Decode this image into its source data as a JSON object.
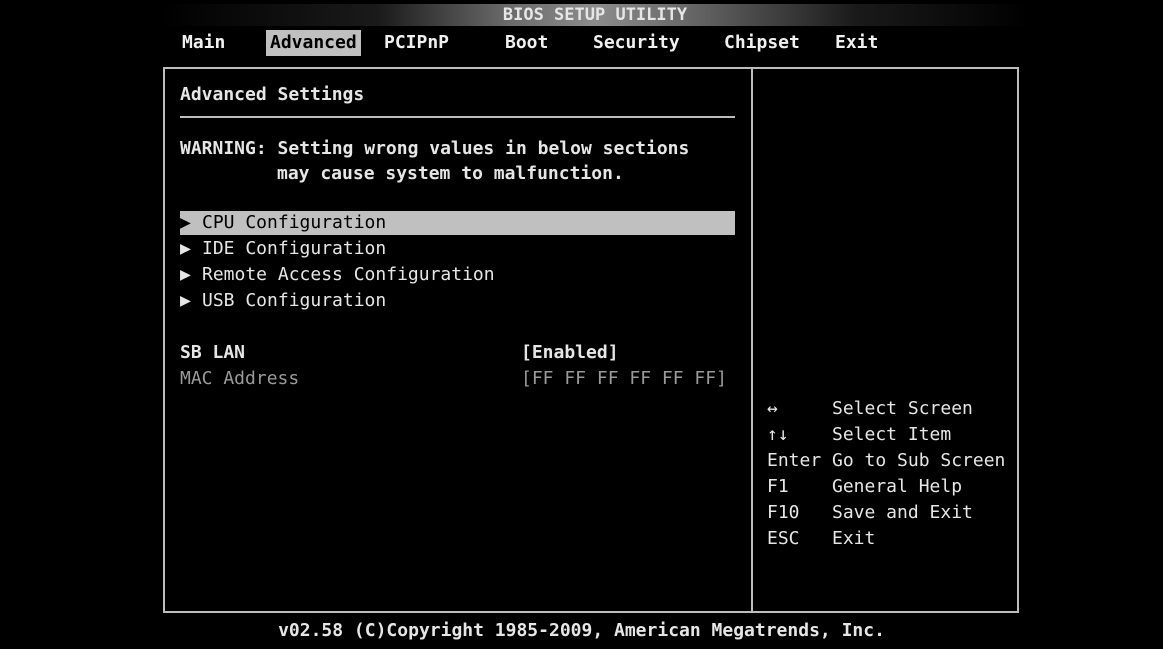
{
  "title": "BIOS SETUP UTILITY",
  "menu": {
    "main": "Main",
    "advanced": "Advanced",
    "pcipnp": "PCIPnP",
    "boot": "Boot",
    "security": "Security",
    "chipset": "Chipset",
    "exit": "Exit",
    "active": "Advanced"
  },
  "panel": {
    "heading": "Advanced Settings",
    "warning_line1": "WARNING: Setting wrong values in below sections",
    "warning_line2": "may cause system to malfunction.",
    "submenus": [
      {
        "label": "CPU Configuration",
        "selected": true
      },
      {
        "label": "IDE Configuration",
        "selected": false
      },
      {
        "label": "Remote Access Configuration",
        "selected": false
      },
      {
        "label": "USB Configuration",
        "selected": false
      }
    ],
    "settings": [
      {
        "label": "SB LAN",
        "value": "[Enabled]"
      },
      {
        "label": "MAC Address",
        "value": "[FF FF FF FF FF FF]"
      }
    ]
  },
  "help": [
    {
      "key": "↔",
      "desc": "Select Screen"
    },
    {
      "key": "↑↓",
      "desc": "Select Item"
    },
    {
      "key": "Enter",
      "desc": "Go to Sub Screen"
    },
    {
      "key": "F1",
      "desc": "General Help"
    },
    {
      "key": "F10",
      "desc": "Save and Exit"
    },
    {
      "key": "ESC",
      "desc": "Exit"
    }
  ],
  "footer": "v02.58 (C)Copyright 1985-2009, American Megatrends, Inc.",
  "icons": {
    "submenu_arrow": "triangle-right-icon",
    "arrow_glyph": "▶"
  },
  "colors": {
    "background": "#000000",
    "foreground": "#e6e6e6",
    "highlight": "#c0c0c0",
    "disabled": "#9a9a9a"
  }
}
